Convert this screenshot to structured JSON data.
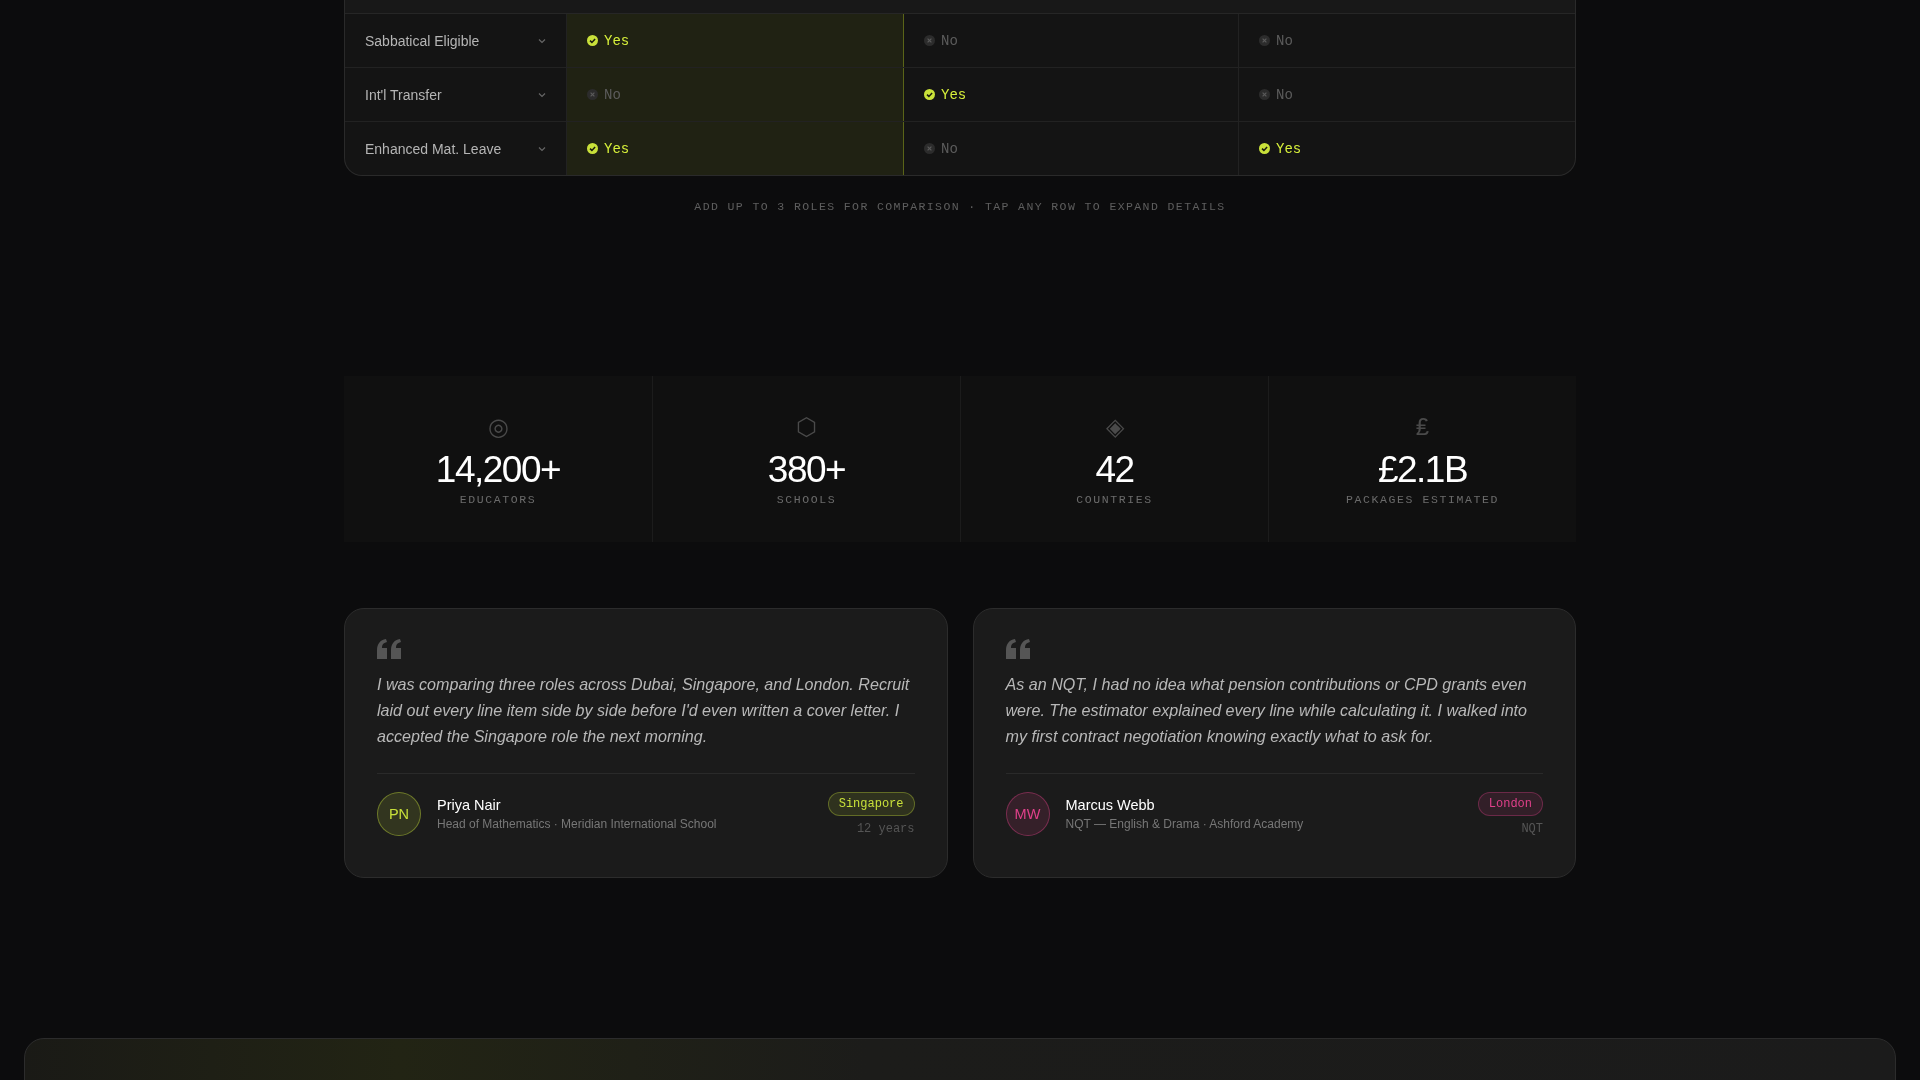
{
  "comparison_table": {
    "columns": [
      {
        "selected": true
      },
      {
        "selected": false
      },
      {
        "selected": false
      }
    ],
    "rows": [
      {
        "label": "Sabbatical Eligible",
        "cells": [
          {
            "included": true,
            "value": "Yes"
          },
          {
            "included": false,
            "value": "No"
          },
          {
            "included": false,
            "value": "No"
          }
        ]
      },
      {
        "label": "Int'l Transfer",
        "cells": [
          {
            "included": false,
            "value": "No"
          },
          {
            "included": true,
            "value": "Yes"
          },
          {
            "included": false,
            "value": "No"
          }
        ]
      },
      {
        "label": "Enhanced Mat. Leave",
        "cells": [
          {
            "included": true,
            "value": "Yes"
          },
          {
            "included": false,
            "value": "No"
          },
          {
            "included": true,
            "value": "Yes"
          }
        ]
      }
    ],
    "note": "ADD UP TO 3 ROLES FOR COMPARISON · TAP ANY ROW TO EXPAND DETAILS"
  },
  "stats": [
    {
      "icon": "◎",
      "value": "14,200+",
      "label": "EDUCATORS"
    },
    {
      "icon": "⬡",
      "value": "380+",
      "label": "SCHOOLS"
    },
    {
      "icon": "◈",
      "value": "42",
      "label": "COUNTRIES"
    },
    {
      "icon": "₤",
      "value": "£2.1B",
      "label": "PACKAGES ESTIMATED"
    }
  ],
  "testimonials": [
    {
      "quote": "I was comparing three roles across Dubai, Singapore, and London. Recruit laid out every line item side by side before I'd even written a cover letter. I accepted the Singapore role the next morning.",
      "initials": "PN",
      "name": "Priya Nair",
      "role": "Head of Mathematics · Meridian International School",
      "tag": "Singapore",
      "color": "#c8e03a",
      "meta": "12 years"
    },
    {
      "quote": "As an NQT, I had no idea what pension contributions or CPD grants even were. The estimator explained every line while calculating it. I walked into my first contract negotiation knowing exactly what to ask for.",
      "initials": "MW",
      "name": "Marcus Webb",
      "role": "NQT — English & Drama · Ashford Academy",
      "tag": "London",
      "color": "#e0408a",
      "meta": "NQT"
    }
  ]
}
